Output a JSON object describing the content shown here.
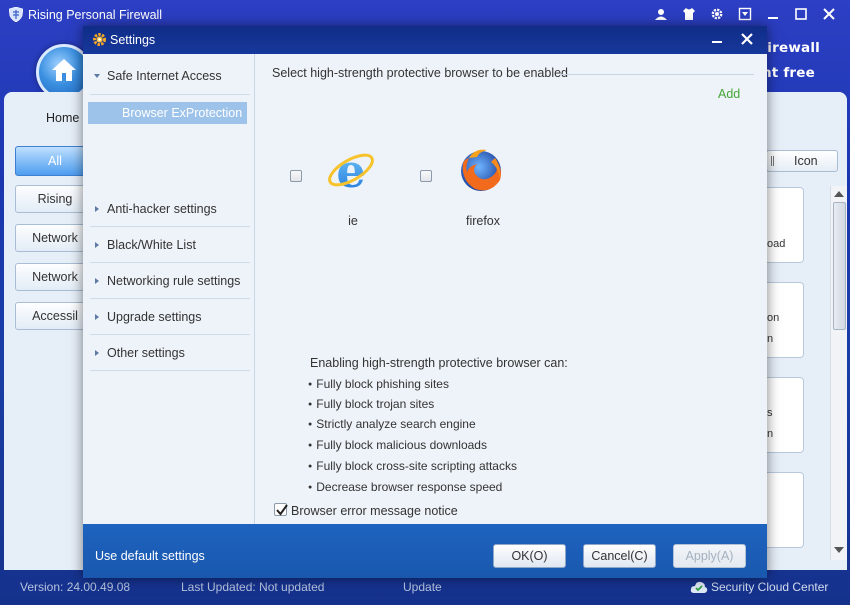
{
  "app": {
    "title": "Rising Personal Firewall",
    "banner_line1": "onal Firewall",
    "banner_line2": "ment free",
    "nav_home": "Home",
    "nav_buttons": [
      "All",
      "Rising",
      "Network",
      "Network",
      "Accessil"
    ],
    "view_button": "Icon",
    "cards": [
      {
        "text": "oad"
      },
      {
        "text": "on",
        "text2": "n"
      },
      {
        "text": "s",
        "text2": "n"
      },
      {
        "text": ""
      }
    ],
    "status": {
      "version": "Version: 24.00.49.08",
      "last_updated": "Last Updated: Not updated",
      "update": "Update",
      "cloud": "Security Cloud Center"
    },
    "colors": {
      "banner_bg": "#1a37b0",
      "accent": "#4d9df0"
    }
  },
  "dialog": {
    "title": "Settings",
    "sidebar": {
      "items": [
        {
          "label": "Safe Internet Access",
          "expanded": true
        },
        {
          "label": "Anti-hacker settings"
        },
        {
          "label": "Black/White List"
        },
        {
          "label": "Networking rule settings"
        },
        {
          "label": "Upgrade settings"
        },
        {
          "label": "Other settings"
        }
      ],
      "selected_sub": "Browser ExProtection"
    },
    "content": {
      "header": "Select high-strength protective browser to be enabled",
      "add": "Add",
      "browsers": [
        {
          "label": "ie",
          "icon": "ie-icon",
          "checked": false
        },
        {
          "label": "firefox",
          "icon": "firefox-icon",
          "checked": false
        }
      ],
      "benefits_title": "Enabling high-strength protective browser can:",
      "benefits": [
        "Fully block phishing sites",
        "Fully block trojan sites",
        "Strictly analyze search engine",
        "Fully block malicious downloads",
        "Fully block cross-site scripting attacks",
        "Decrease browser response speed"
      ],
      "notice_label": "Browser error message notice",
      "notice_checked": true
    },
    "footer": {
      "default_link": "Use default settings",
      "ok": "OK(O)",
      "cancel": "Cancel(C)",
      "apply": "Apply(A)"
    }
  }
}
